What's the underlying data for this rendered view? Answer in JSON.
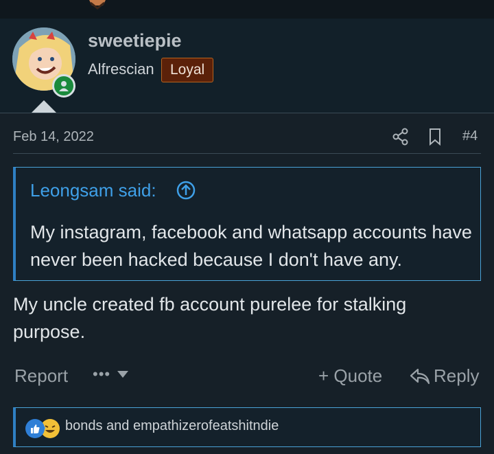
{
  "post": {
    "author": {
      "username": "sweetiepie",
      "title": "Alfrescian",
      "badge": "Loyal",
      "status": "online"
    },
    "date": "Feb 14, 2022",
    "number": "#4",
    "quote": {
      "author_label": "Leongsam said:",
      "text": "My instagram, facebook and whatsapp accounts have never been hacked because I don't have any."
    },
    "body": "My uncle created fb account purelee for stalking purpose.",
    "actions": {
      "report": "Report",
      "more": "•••",
      "quote": "+ Quote",
      "reply": "Reply"
    },
    "reactions": {
      "icons": [
        "like-icon",
        "laugh-icon"
      ],
      "names": "bonds and empathizerofeatshitndie"
    }
  },
  "colors": {
    "background": "#162028",
    "accent": "#3fa0e8",
    "badge_bg": "#5b2109",
    "online": "#1a8a3c"
  }
}
